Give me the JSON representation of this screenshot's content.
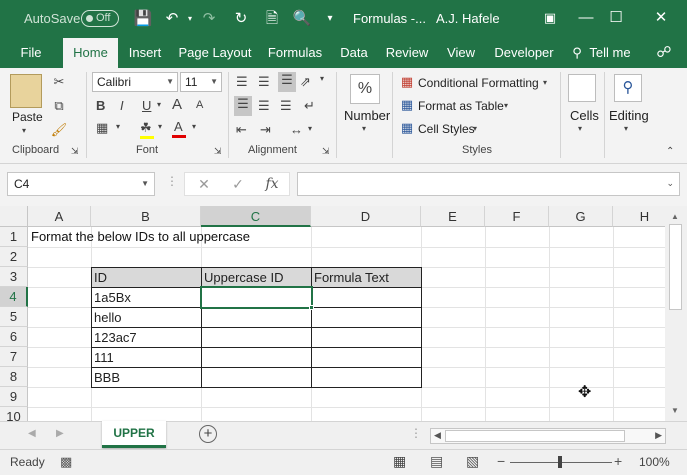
{
  "titlebar": {
    "autosave_label": "AutoSave",
    "autosave_state": "Off",
    "doc_title": "Formulas -...",
    "user_name": "A.J. Hafele"
  },
  "tabs": [
    "File",
    "Home",
    "Insert",
    "Page Layout",
    "Formulas",
    "Data",
    "Review",
    "View",
    "Developer",
    "Tell me"
  ],
  "ribbon": {
    "paste_label": "Paste",
    "font_name": "Calibri",
    "font_size": "11",
    "number_label": "Number",
    "number_symbol": "%",
    "conditional_formatting": "Conditional Formatting",
    "format_as_table": "Format as Table",
    "cell_styles": "Cell Styles",
    "cells_label": "Cells",
    "editing_label": "Editing",
    "groups": {
      "clipboard": "Clipboard",
      "font": "Font",
      "alignment": "Alignment",
      "styles": "Styles"
    }
  },
  "formula_bar": {
    "name_box": "C4",
    "formula": "",
    "fx_label": "fx"
  },
  "grid": {
    "columns": [
      "A",
      "B",
      "C",
      "D",
      "E",
      "F",
      "G",
      "H"
    ],
    "rows": [
      "1",
      "2",
      "3",
      "4",
      "5",
      "6",
      "7",
      "8",
      "9",
      "10"
    ],
    "a1_text": "Format the below IDs to all uppercase",
    "table_headers": [
      "ID",
      "Uppercase ID",
      "Formula Text"
    ],
    "table_ids": [
      "1a5Bx",
      "hello",
      "123ac7",
      "111",
      "BBB"
    ]
  },
  "sheet": {
    "active_tab": "UPPER"
  },
  "status": {
    "ready": "Ready",
    "zoom": "100%"
  },
  "colors": {
    "accent": "#217346",
    "header_fill": "#d9d9d9"
  }
}
